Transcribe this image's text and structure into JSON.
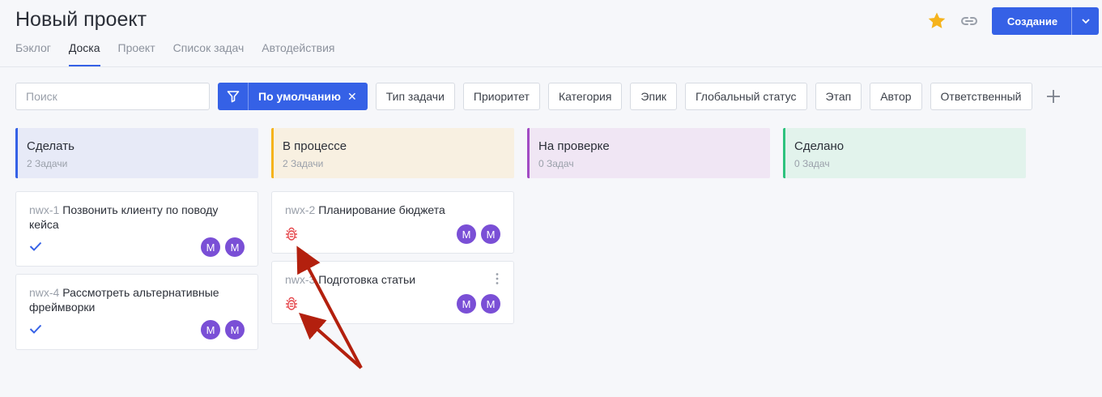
{
  "header": {
    "title": "Новый проект",
    "tabs": [
      {
        "label": "Бэклог",
        "active": false
      },
      {
        "label": "Доска",
        "active": true
      },
      {
        "label": "Проект",
        "active": false
      },
      {
        "label": "Список задач",
        "active": false
      },
      {
        "label": "Автодействия",
        "active": false
      }
    ],
    "create_label": "Создание",
    "icons": [
      "star-icon",
      "link-icon",
      "chevron-down-icon"
    ]
  },
  "filters": {
    "search_placeholder": "Поиск",
    "preset_label": "По умолчанию",
    "buttons": [
      "Тип задачи",
      "Приоритет",
      "Категория",
      "Эпик",
      "Глобальный статус",
      "Этап",
      "Автор",
      "Ответственный"
    ]
  },
  "columns": [
    {
      "title": "Сделать",
      "count": "2 Задачи",
      "color": "#3561e6",
      "bg": "#e7eaf7"
    },
    {
      "title": "В процессе",
      "count": "2 Задачи",
      "color": "#f5b31c",
      "bg": "#f8f0e1"
    },
    {
      "title": "На проверке",
      "count": "0 Задач",
      "color": "#a24cc4",
      "bg": "#f0e6f4"
    },
    {
      "title": "Сделано",
      "count": "0 Задач",
      "color": "#2ec27e",
      "bg": "#e2f3ec"
    }
  ],
  "cards": {
    "c1": {
      "key": "nwx-1",
      "title": "Позвонить клиенту по поводу кейса",
      "avatars": [
        "M",
        "M"
      ]
    },
    "c2": {
      "key": "nwx-4",
      "title": "Рассмотреть альтернативные фреймворки",
      "avatars": [
        "M",
        "M"
      ]
    },
    "c3": {
      "key": "nwx-2",
      "title": "Планирование бюджета",
      "avatars": [
        "M",
        "M"
      ]
    },
    "c4": {
      "key": "nwx-3",
      "title": "Подготовка статьи",
      "avatars": [
        "M",
        "M"
      ]
    }
  },
  "colors": {
    "accent": "#3561e6",
    "avatar": "#7a4fd6",
    "bug": "#e5484d",
    "arrow": "#b3200e"
  }
}
